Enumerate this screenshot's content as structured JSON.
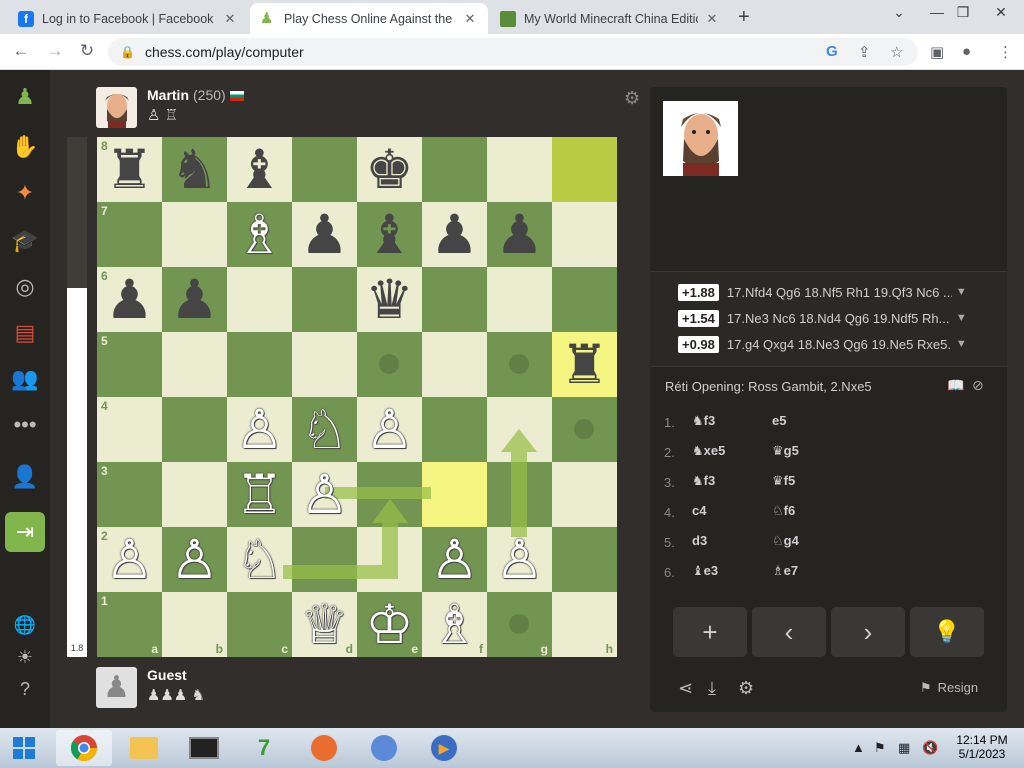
{
  "browser": {
    "tabs": [
      {
        "title": "Log in to Facebook | Facebook",
        "active": false
      },
      {
        "title": "Play Chess Online Against the Co",
        "active": true
      },
      {
        "title": "My World Minecraft China Editio",
        "active": false
      }
    ],
    "url": "chess.com/play/computer"
  },
  "colors": {
    "accent": "#81b64c",
    "board_light": "#ebecd0",
    "board_dark": "#739552",
    "highlight": "#f5f682"
  },
  "top_player": {
    "name": "Martin",
    "rating": "(250)",
    "captured": "♙ ♖"
  },
  "bottom_player": {
    "name": "Guest",
    "captured": "♟♟♟ ♞"
  },
  "eval_bar": {
    "value": "1.8",
    "white_fraction": 0.71
  },
  "board": {
    "files": [
      "a",
      "b",
      "c",
      "d",
      "e",
      "f",
      "g",
      "h"
    ],
    "ranks": [
      "8",
      "7",
      "6",
      "5",
      "4",
      "3",
      "2",
      "1"
    ],
    "pieces": [
      {
        "sq": "a8",
        "p": "♜",
        "c": "b"
      },
      {
        "sq": "b8",
        "p": "♞",
        "c": "b"
      },
      {
        "sq": "c8",
        "p": "♝",
        "c": "b"
      },
      {
        "sq": "e8",
        "p": "♚",
        "c": "b"
      },
      {
        "sq": "c7",
        "p": "♗",
        "c": "w"
      },
      {
        "sq": "d7",
        "p": "♟",
        "c": "b"
      },
      {
        "sq": "e7",
        "p": "♝",
        "c": "b"
      },
      {
        "sq": "f7",
        "p": "♟",
        "c": "b"
      },
      {
        "sq": "g7",
        "p": "♟",
        "c": "b"
      },
      {
        "sq": "a6",
        "p": "♟",
        "c": "b"
      },
      {
        "sq": "b6",
        "p": "♟",
        "c": "b"
      },
      {
        "sq": "e6",
        "p": "♛",
        "c": "b"
      },
      {
        "sq": "h5",
        "p": "♜",
        "c": "b"
      },
      {
        "sq": "c4",
        "p": "♙",
        "c": "w"
      },
      {
        "sq": "d4",
        "p": "♘",
        "c": "w"
      },
      {
        "sq": "e4",
        "p": "♙",
        "c": "w"
      },
      {
        "sq": "c3",
        "p": "♖",
        "c": "w"
      },
      {
        "sq": "d3",
        "p": "♙",
        "c": "w"
      },
      {
        "sq": "a2",
        "p": "♙",
        "c": "w"
      },
      {
        "sq": "b2",
        "p": "♙",
        "c": "w"
      },
      {
        "sq": "c2",
        "p": "♘",
        "c": "w"
      },
      {
        "sq": "f2",
        "p": "♙",
        "c": "w"
      },
      {
        "sq": "g2",
        "p": "♙",
        "c": "w"
      },
      {
        "sq": "d1",
        "p": "♕",
        "c": "w"
      },
      {
        "sq": "e1",
        "p": "♔",
        "c": "w"
      },
      {
        "sq": "f1",
        "p": "♗",
        "c": "w"
      }
    ],
    "highlights": [
      "h8",
      "h5",
      "f3"
    ],
    "dots": [
      "e5",
      "g5",
      "h4",
      "g1"
    ]
  },
  "engine_lines": [
    {
      "eval": "+1.88",
      "line": "17.Nfd4 Qg6 18.Nf5 Rh1 19.Qf3 Nc6 ..."
    },
    {
      "eval": "+1.54",
      "line": "17.Ne3 Nc6 18.Nd4 Qg6 19.Ndf5 Rh..."
    },
    {
      "eval": "+0.98",
      "line": "17.g4 Qxg4 18.Ne3 Qg6 19.Ne5 Rxe5..."
    }
  ],
  "opening": "Réti Opening: Ross Gambit, 2.Nxe5",
  "moves": [
    {
      "n": "1.",
      "w": "♞f3",
      "b": "e5"
    },
    {
      "n": "2.",
      "w": "♞xe5",
      "b": "♛g5"
    },
    {
      "n": "3.",
      "w": "♞f3",
      "b": "♛f5"
    },
    {
      "n": "4.",
      "w": "c4",
      "b": "♘f6"
    },
    {
      "n": "5.",
      "w": "d3",
      "b": "♘g4"
    },
    {
      "n": "6.",
      "w": "♝e3",
      "b": "♗e7"
    }
  ],
  "controls": {
    "add": "+",
    "prev": "‹",
    "next": "›",
    "hint": "💡"
  },
  "resign_label": "Resign",
  "clock": {
    "time": "12:14 PM",
    "date": "5/1/2023"
  }
}
